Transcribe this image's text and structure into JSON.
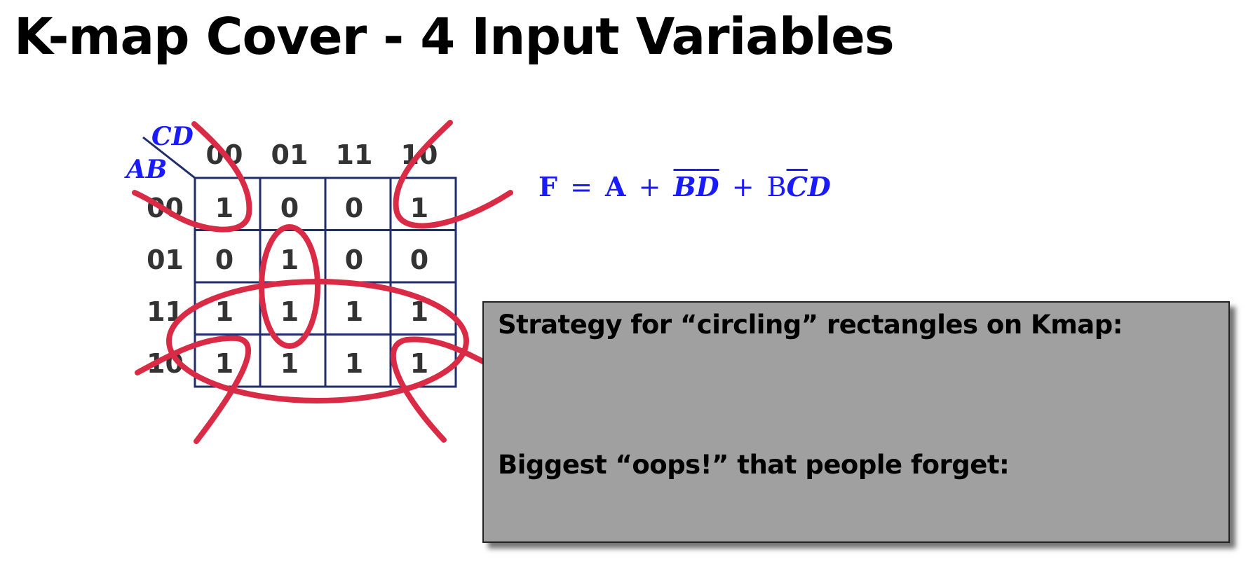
{
  "title": "K-map Cover - 4 Input Variables",
  "kmap": {
    "row_var": "AB",
    "col_var": "CD",
    "col_labels": [
      "00",
      "01",
      "11",
      "10"
    ],
    "row_labels": [
      "00",
      "01",
      "11",
      "10"
    ],
    "cells": [
      [
        "1",
        "0",
        "0",
        "1"
      ],
      [
        "0",
        "1",
        "0",
        "0"
      ],
      [
        "1",
        "1",
        "1",
        "1"
      ],
      [
        "1",
        "1",
        "1",
        "1"
      ]
    ],
    "grid_color": "#1f2d6b",
    "circle_color": "#d92b45",
    "variable_color": "#1a1aff"
  },
  "equation": {
    "lhs": "F",
    "equals": "=",
    "term1": "A",
    "plus1": "+",
    "term2_var1": "B",
    "term2_var2": "D",
    "plus2": "+",
    "term3_var1": "B",
    "term3_var2": "C",
    "term3_var3": "D"
  },
  "strategy_box": {
    "question1": "Strategy for “circling” rectangles on Kmap:",
    "question2": "Biggest “oops!” that people forget:",
    "background": "#a0a0a0"
  }
}
